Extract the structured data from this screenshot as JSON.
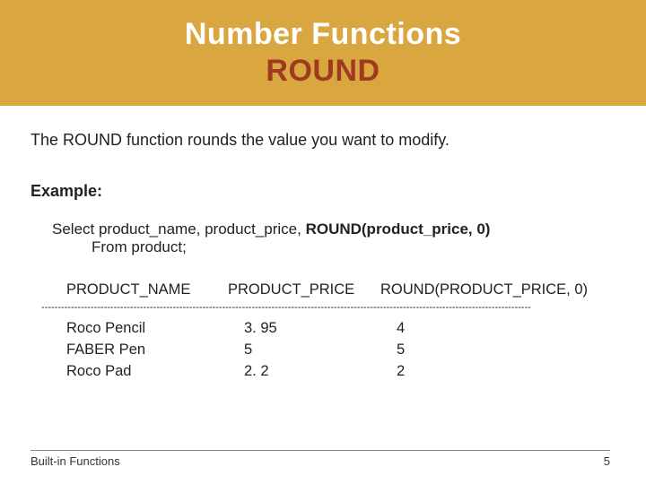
{
  "title": {
    "line1": "Number Functions",
    "line2": "ROUND"
  },
  "description": "The ROUND function rounds the value you want to modify.",
  "example_label": "Example:",
  "query": {
    "line1_pre": "Select  product_name, product_price, ",
    "line1_bold": "ROUND(product_price, 0)",
    "line2": "From product;"
  },
  "result": {
    "headers": {
      "c1": "PRODUCT_NAME",
      "c2": "PRODUCT_PRICE",
      "c3": "ROUND(PRODUCT_PRICE, 0)"
    },
    "divider": "-----------------------------------------------------------------------------------------------------------------------------------------------------",
    "rows": [
      {
        "c1": "Roco Pencil",
        "c2": "3. 95",
        "c3": "4"
      },
      {
        "c1": "FABER Pen",
        "c2": "5",
        "c3": "5"
      },
      {
        "c1": "Roco Pad",
        "c2": "2. 2",
        "c3": "2"
      }
    ]
  },
  "footer": {
    "left": "Built-in Functions",
    "right": "5"
  }
}
